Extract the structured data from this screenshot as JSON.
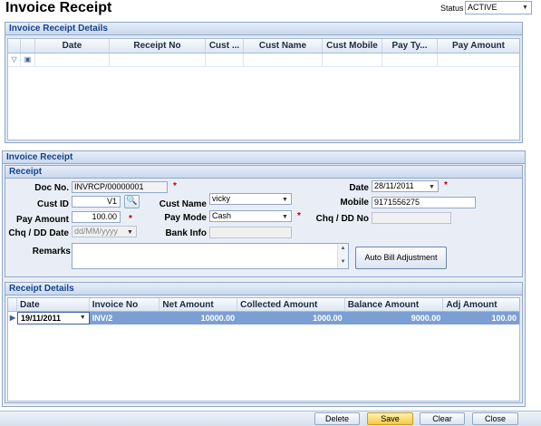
{
  "page": {
    "title": "Invoice Receipt"
  },
  "status": {
    "label": "Status",
    "value": "ACTIVE"
  },
  "details_panel": {
    "title": "Invoice Receipt Details",
    "columns": [
      "Date",
      "Receipt No",
      "Cust ...",
      "Cust Name",
      "Cust Mobile",
      "Pay Ty...",
      "Pay Amount"
    ]
  },
  "receipt_section": {
    "title": "Invoice Receipt",
    "subtitle": "Receipt"
  },
  "form": {
    "doc_no_label": "Doc No.",
    "doc_no": "INVRCP/00000001",
    "date_label": "Date",
    "date": "28/11/2011",
    "cust_id_label": "Cust ID",
    "cust_id": "V1",
    "cust_name_label": "Cust Name",
    "cust_name": "vicky",
    "mobile_label": "Mobile",
    "mobile": "9171556275",
    "pay_amount_label": "Pay Amount",
    "pay_amount": "100.00",
    "pay_mode_label": "Pay Mode",
    "pay_mode": "Cash",
    "chq_no_label": "Chq / DD No",
    "chq_no": "",
    "chq_date_label": "Chq / DD Date",
    "chq_date_placeholder": "dd/MM/yyyy",
    "bank_info_label": "Bank Info",
    "bank_info": "",
    "remarks_label": "Remarks",
    "remarks": "",
    "auto_bill_label": "Auto Bill Adjustment",
    "required_mark": "*"
  },
  "receipt_details": {
    "title": "Receipt Details",
    "columns": [
      "Date",
      "Invoice No",
      "Net Amount",
      "Collected Amount",
      "Balance Amount",
      "Adj Amount"
    ],
    "rows": [
      {
        "date": "19/11/2011",
        "invoice_no": "INV/2",
        "net_amount": "10000.00",
        "collected_amount": "1000.00",
        "balance_amount": "9000.00",
        "adj_amount": "100.00"
      }
    ]
  },
  "footer": {
    "delete": "Delete",
    "save": "Save",
    "clear": "Clear",
    "close": "Close"
  }
}
